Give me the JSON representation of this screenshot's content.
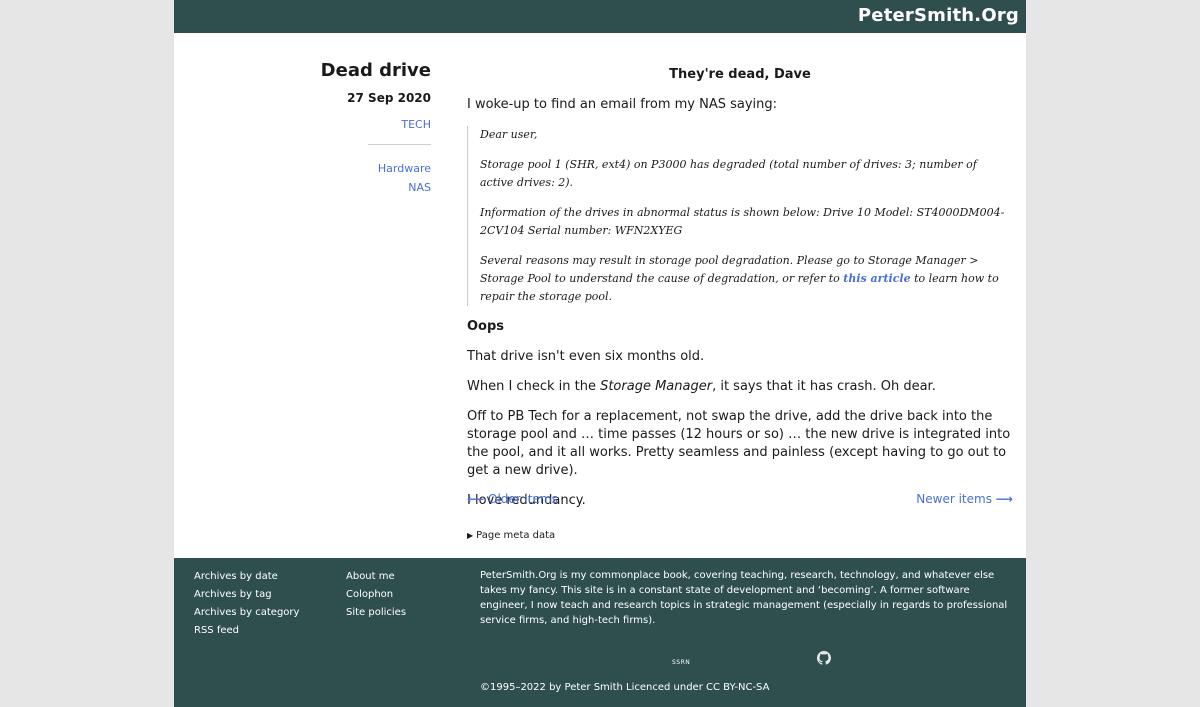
{
  "header": {
    "site_title": "PeterSmith.Org"
  },
  "meta": {
    "title": "Dead drive",
    "date": "27 Sep 2020",
    "category": "TECH",
    "tags": [
      "Hardware",
      "NAS"
    ]
  },
  "article": {
    "subtitle": "They're dead, Dave",
    "intro": "I woke-up to find an email from my NAS saying:",
    "quote": {
      "greeting": "Dear user,",
      "line1": "Storage pool 1 (SHR, ext4) on P3000 has degraded (total number of drives: 3; number of active drives: 2).",
      "line2": "Information of the drives in abnormal status is shown below: Drive 10 Model: ST4000DM004-2CV104 Serial number: WFN2XYEG",
      "line3_before": "Several reasons may result in storage pool degradation. Please go to Storage Manager > Storage Pool to understand the cause of degradation, or refer to ",
      "line3_link": "this article",
      "line3_after": " to learn how to repair the storage pool."
    },
    "heading": "Oops",
    "para1": "That drive isn't even six months old.",
    "para2_before": "When I check in the ",
    "para2_em": "Storage Manager",
    "para2_after": ", it says that it has crash. Oh dear.",
    "para3": "Off to PB Tech for a replacement, not swap the drive, add the drive back into the storage pool and … time passes (12 hours or so) … the new drive is integrated into the pool, and it all works. Pretty seamless and painless (except having to go out to get a new drive).",
    "para4": "I love redundancy."
  },
  "pager": {
    "older": "Older items",
    "newer": "Newer items",
    "older_arrow": "⟵",
    "newer_arrow": "⟶"
  },
  "page_meta_toggle": "Page meta data",
  "footer": {
    "col1": [
      "Archives by date",
      "Archives by tag",
      "Archives by category",
      "RSS feed"
    ],
    "col2": [
      "About me",
      "Colophon",
      "Site policies"
    ],
    "desc1": "PeterSmith.Org is my commonplace book, covering teaching, research, technology, and whatever else takes my fancy. This site is in a constant state of development and ‘becoming’. A former software engineer, I now teach and research topics in strategic management (especially in regards to professional service firms, and high-tech firms).",
    "ssrn": "SSRN",
    "github_icon": "github-icon",
    "copyright": "©1995–2022 by Peter Smith Licenced under CC BY-NC-SA"
  },
  "colors": {
    "brand": "#2f4f4f",
    "link": "#4a6fd8",
    "background": "#e6e6e6"
  }
}
